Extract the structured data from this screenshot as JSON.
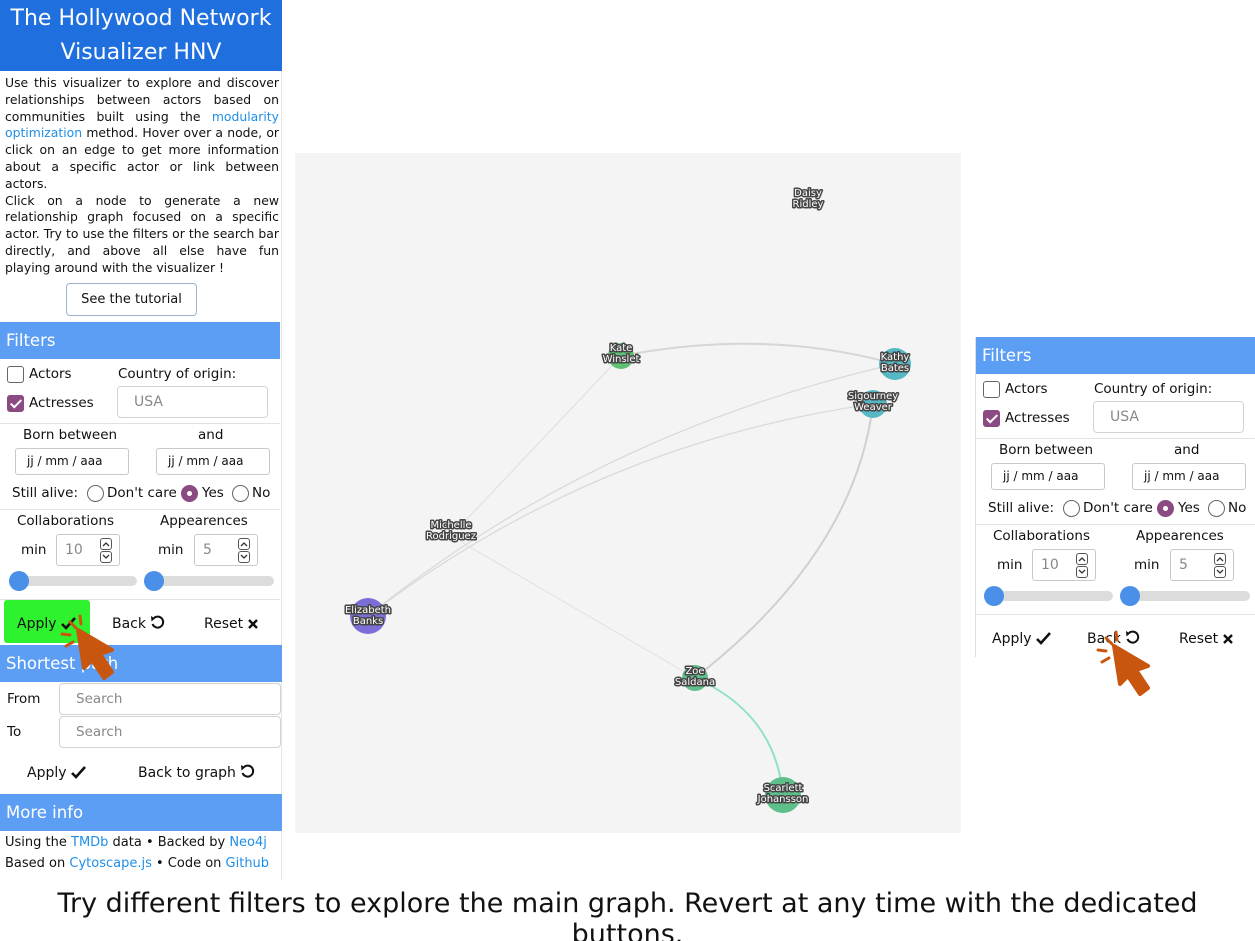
{
  "sidebar": {
    "title_line1": "The Hollywood Network",
    "title_line2": "Visualizer HNV",
    "intro_a": "Use this visualizer to explore and discover relationships between actors based on communities built using the ",
    "intro_link": "modularity optimization",
    "intro_b": " method. Hover over a node, or click on an edge to get more information about a specific actor or link between actors.",
    "intro_c": "Click on a node to generate a new relationship graph focused on a specific actor. Try to use the filters or the search bar directly, and above all else have fun playing around with the visualizer !",
    "tutorial_label": "See the tutorial"
  },
  "filters": {
    "header": "Filters",
    "actors_label": "Actors",
    "actors_checked": false,
    "actresses_label": "Actresses",
    "actresses_checked": true,
    "country_label": "Country of origin:",
    "country_placeholder": "USA",
    "born_between_label": "Born between",
    "and_label": "and",
    "date_placeholder": "jj / mm / aaa",
    "still_alive_label": "Still alive:",
    "dont_care_label": "Don't care",
    "yes_label": "Yes",
    "no_label": "No",
    "still_alive_value": "Yes",
    "collaborations_label": "Collaborations",
    "appearences_label": "Appearences",
    "min_label": "min",
    "collaborations_min": "10",
    "appearences_min": "5",
    "apply_label": "Apply",
    "back_label": "Back",
    "reset_label": "Reset"
  },
  "shortest_path": {
    "header": "Shortest path",
    "from_label": "From",
    "to_label": "To",
    "search_placeholder": "Search",
    "apply_label": "Apply",
    "back_to_graph_label": "Back to graph"
  },
  "more_info": {
    "header": "More info",
    "line1_a": "Using the ",
    "line1_link1": "TMDb",
    "line1_b": " data • Backed by ",
    "line1_link2": "Neo4j",
    "line2_a": "Based on ",
    "line2_link1": "Cytoscape.js",
    "line2_b": " • Code on ",
    "line2_link2": "Github"
  },
  "graph": {
    "nodes": [
      {
        "id": "daisy",
        "line1": "Daisy",
        "line2": "Ridley",
        "color": "#f4f4f4"
      },
      {
        "id": "kate",
        "line1": "Kate",
        "line2": "Winslet",
        "color": "#5fbf73"
      },
      {
        "id": "kathy",
        "line1": "Kathy",
        "line2": "Bates",
        "color": "#56b8c4"
      },
      {
        "id": "sigourney",
        "line1": "Sigourney",
        "line2": "Weaver",
        "color": "#56b8c4"
      },
      {
        "id": "michelle",
        "line1": "Michelle",
        "line2": "Rodriguez",
        "color": "#f4f4f4"
      },
      {
        "id": "elizabeth",
        "line1": "Elizabeth",
        "line2": "Banks",
        "color": "#7a6fd6"
      },
      {
        "id": "zoe",
        "line1": "Zoe",
        "line2": "Saldana",
        "color": "#5fbf8a"
      },
      {
        "id": "scarlett",
        "line1": "Scarlett",
        "line2": "Johansson",
        "color": "#5fbf8a"
      }
    ]
  },
  "caption": "Try different filters to explore the main graph. Revert at any time with the dedicated buttons.",
  "colors": {
    "title_bg": "#1f6fde",
    "section_bg": "#5d9ef5",
    "accent_purple": "#8c4a82",
    "apply_highlight": "#2ff22f",
    "cursor_orange": "#c9560f"
  }
}
